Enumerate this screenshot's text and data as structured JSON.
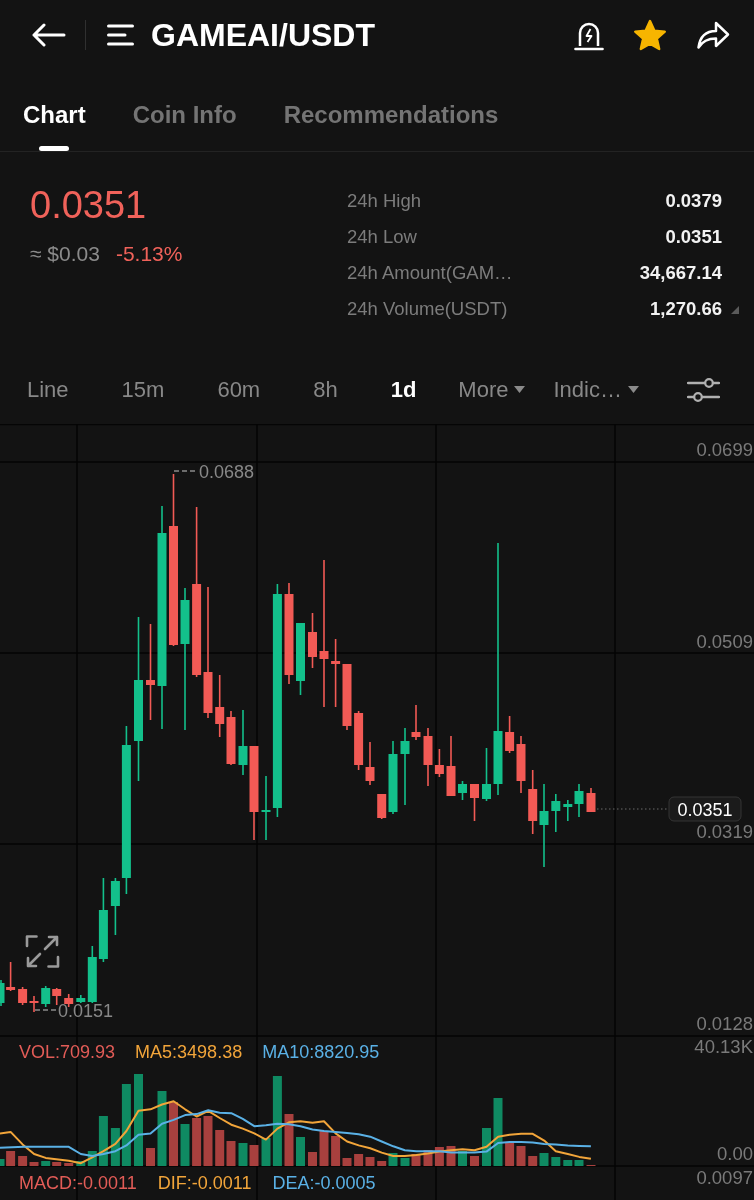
{
  "header": {
    "title": "GAMEAI/USDT",
    "favorited": true
  },
  "tabs": [
    {
      "label": "Chart",
      "selected": true
    },
    {
      "label": "Coin Info",
      "selected": false
    },
    {
      "label": "Recommendations",
      "selected": false
    }
  ],
  "ticker": {
    "price": "0.0351",
    "fiat": "≈ $0.03",
    "change": "-5.13%",
    "falling": true
  },
  "stats": [
    {
      "label": "24h High",
      "value": "0.0379"
    },
    {
      "label": "24h Low",
      "value": "0.0351"
    },
    {
      "label": "24h Amount(GAM…",
      "value": "34,667.14"
    },
    {
      "label": "24h Volume(USDT)",
      "value": "1,270.66"
    }
  ],
  "intervals": [
    {
      "label": "Line",
      "kind": "option",
      "selected": false
    },
    {
      "label": "15m",
      "kind": "option",
      "selected": false
    },
    {
      "label": "60m",
      "kind": "option",
      "selected": false
    },
    {
      "label": "8h",
      "kind": "option",
      "selected": false
    },
    {
      "label": "1d",
      "kind": "option",
      "selected": true
    },
    {
      "label": "More",
      "kind": "menu",
      "selected": false
    },
    {
      "label": "Indic…",
      "kind": "menu",
      "selected": false
    }
  ],
  "price_chart": {
    "axis_labels": [
      "0.0699",
      "0.0509",
      "0.0319",
      "0.0128"
    ],
    "high_label": "0.0688",
    "low_label": "0.0151",
    "last_price": "0.0351"
  },
  "volume": {
    "legend": [
      {
        "label": "VOL:709.93",
        "color": "#e25c57"
      },
      {
        "label": "MA5:3498.38",
        "color": "#f2a53a"
      },
      {
        "label": "MA10:8820.95",
        "color": "#5ab1e6"
      }
    ],
    "axis_labels": [
      "40.13K",
      "0.00"
    ]
  },
  "macd": {
    "legend": [
      {
        "label": "MACD:-0.0011",
        "color": "#e25c57"
      },
      {
        "label": "DIF:-0.0011",
        "color": "#f2a53a"
      },
      {
        "label": "DEA:-0.0005",
        "color": "#5ab1e6"
      }
    ],
    "axis_labels": [
      "0.0097"
    ]
  }
}
